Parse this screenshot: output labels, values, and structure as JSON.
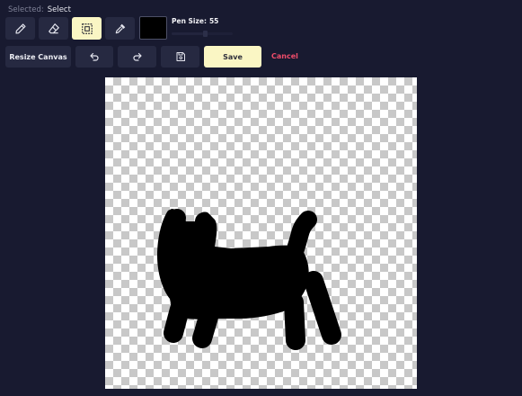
{
  "selected": {
    "label": "Selected:",
    "value": "Select"
  },
  "tools": [
    {
      "name": "pencil-icon",
      "active": false
    },
    {
      "name": "eraser-icon",
      "active": false
    },
    {
      "name": "select-icon",
      "active": true
    },
    {
      "name": "eyedropper-icon",
      "active": false
    }
  ],
  "color": {
    "current": "#000000"
  },
  "pen": {
    "label": "Pen Size:",
    "value": "55",
    "slider_level": 0.55
  },
  "actions": {
    "resize_label": "Resize Canvas",
    "undo_icon": "undo-icon",
    "redo_icon": "redo-icon",
    "disk_icon": "save-icon",
    "save_label": "Save",
    "cancel_label": "Cancel"
  },
  "colors": {
    "background": "#181a30",
    "button": "#262941",
    "accent": "#faf6c4",
    "cancel": "#ee4c6a",
    "ink": "#000000"
  }
}
